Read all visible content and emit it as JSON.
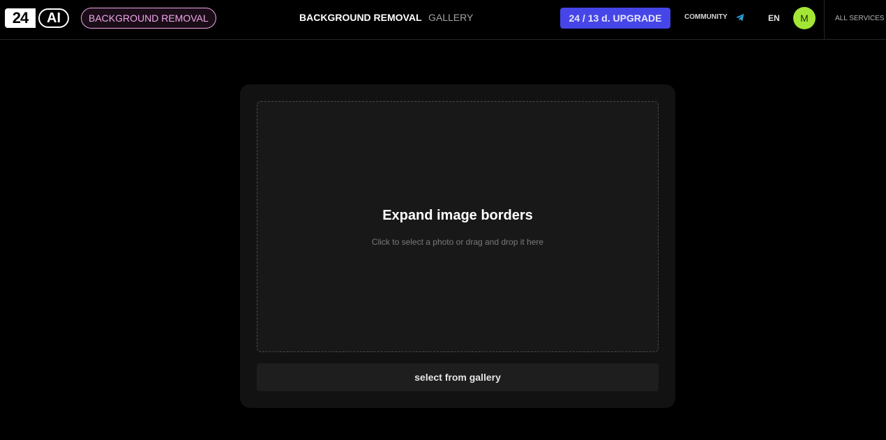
{
  "header": {
    "logo": {
      "num": "24",
      "ai": "AI"
    },
    "service_pill": "BACKGROUND REMOVAL",
    "nav": {
      "main": "BACKGROUND REMOVAL",
      "gallery": "GALLERY"
    },
    "upgrade_label": "24 / 13 d. UPGRADE",
    "community_label": "COMMUNITY",
    "language": "EN",
    "avatar_initial": "M",
    "all_services": "ALL SERVICES"
  },
  "upload": {
    "title": "Expand image borders",
    "hint": "Click to select a photo or drag and drop it here",
    "gallery_button": "select from gallery"
  },
  "icons": {
    "community": "telegram-icon"
  },
  "colors": {
    "accent": "#4646e8",
    "pill": "#f3a7ea",
    "avatar": "#a3e635",
    "telegram": "#2aa3de"
  }
}
